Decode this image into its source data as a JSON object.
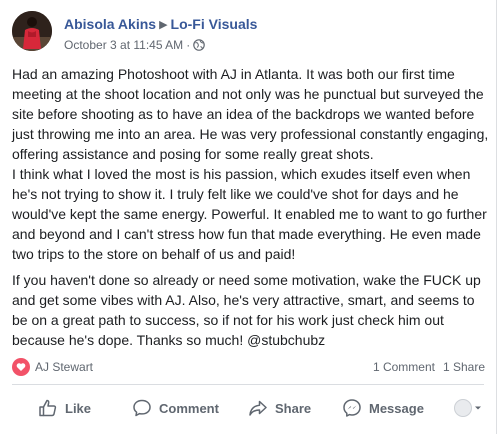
{
  "post": {
    "author": "Abisola Akins",
    "page": "Lo-Fi Visuals",
    "timestamp": "October 3 at 11:45 AM",
    "separator": "·",
    "audience_icon": "globe-icon",
    "paragraphs": [
      "Had an amazing Photoshoot with AJ in Atlanta. It was both our first time meeting at the shoot location and not only was he punctual but surveyed the site before shooting as to have an idea of the backdrops we wanted before just throwing me into an area. He was very professional constantly engaging, offering assistance and posing for some really great shots.",
      "I think what I loved the most is his passion, which exudes itself even when he's not trying to show it. I truly felt like we could've shot for days and he would've kept the same energy. Powerful. It enabled me to want to go further and beyond and I can't stress how fun that made everything. He even made two trips to the store on behalf of us and paid!",
      "If you haven't done so already or need some motivation, wake the FUCK up and get some vibes with AJ. Also, he's very attractive, smart, and seems to be on a great path to success, so if not for his work just check him out because he's dope. Thanks so much! @stubchubz"
    ]
  },
  "engagement": {
    "reaction_icon": "love-icon",
    "reactor": "AJ Stewart",
    "comments": "1 Comment",
    "shares": "1 Share"
  },
  "actions": {
    "like": "Like",
    "comment": "Comment",
    "share": "Share",
    "message": "Message"
  },
  "colors": {
    "link_blue": "#385898",
    "love_red": "#f25268",
    "muted_gray": "#606770",
    "divider": "#dadde1"
  }
}
